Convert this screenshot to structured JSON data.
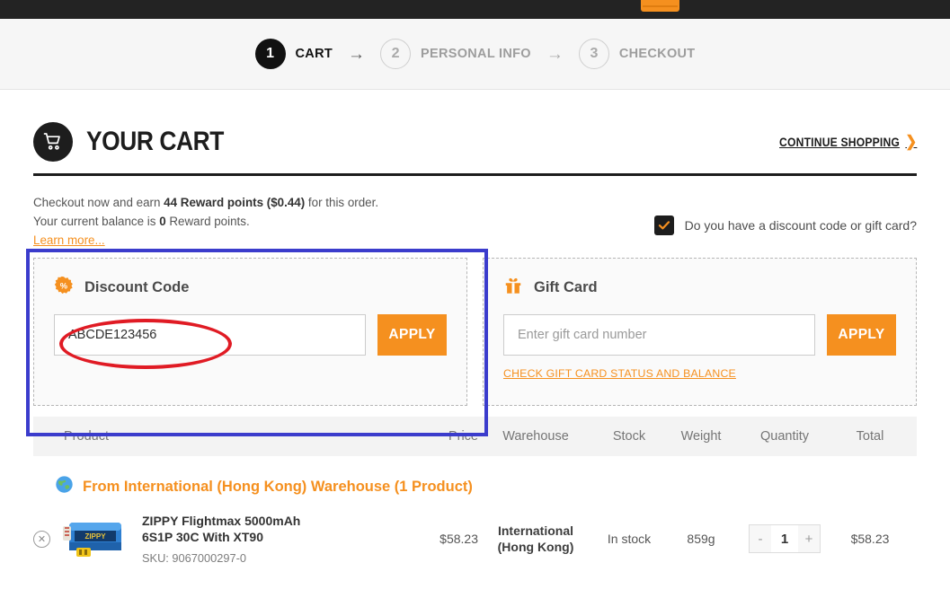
{
  "topbar": {
    "logo": "logo-mark"
  },
  "steps": [
    {
      "num": "1",
      "label": "CART",
      "state": "active"
    },
    {
      "num": "2",
      "label": "PERSONAL INFO",
      "state": "idle"
    },
    {
      "num": "3",
      "label": "CHECKOUT",
      "state": "idle"
    }
  ],
  "step_arrow": "→",
  "header": {
    "title": "YOUR CART",
    "cart_icon": "shopping-cart-icon",
    "continue_label": "CONTINUE SHOPPING",
    "continue_chevron": "❯"
  },
  "rewards": {
    "line1_pre": "Checkout now and earn ",
    "line1_bold": "44 Reward points ($0.44)",
    "line1_post": " for this order.",
    "line2_pre": "Your current balance is ",
    "line2_bold": "0",
    "line2_post": " Reward points.",
    "learn_more": "Learn more..."
  },
  "discount_question": {
    "label": "Do you have a discount code or gift card?",
    "checked": true,
    "check_glyph": "✓"
  },
  "discount_panel": {
    "icon": "percent-badge-icon",
    "title": "Discount Code",
    "input_value": "ABCDE123456",
    "input_placeholder": "",
    "apply_label": "APPLY"
  },
  "gift_panel": {
    "icon": "gift-box-icon",
    "title": "Gift Card",
    "input_value": "",
    "input_placeholder": "Enter gift card number",
    "apply_label": "APPLY",
    "status_link": "CHECK GIFT CARD STATUS AND BALANCE"
  },
  "table": {
    "columns": {
      "product": "Product",
      "price": "Price",
      "warehouse": "Warehouse",
      "stock": "Stock",
      "weight": "Weight",
      "quantity": "Quantity",
      "total": "Total"
    },
    "group_header": {
      "icon": "globe-icon",
      "label": "From International (Hong Kong) Warehouse (1 Product)"
    },
    "rows": [
      {
        "remove_icon": "remove-item-icon",
        "thumb": "lipo-battery-image",
        "name": "ZIPPY Flightmax 5000mAh 6S1P 30C With XT90",
        "sku": "SKU: 9067000297-0",
        "price": "$58.23",
        "warehouse": "International (Hong Kong)",
        "stock": "In stock",
        "weight": "859g",
        "qty_minus": "-",
        "qty": "1",
        "qty_plus": "+",
        "total": "$58.23"
      }
    ]
  },
  "annotations": {
    "highlight_box_color": "#3b3ccc",
    "ellipse_color": "#e01b24"
  },
  "colors": {
    "accent": "#f5901f",
    "dark": "#1d1d1d",
    "muted": "#757575"
  }
}
